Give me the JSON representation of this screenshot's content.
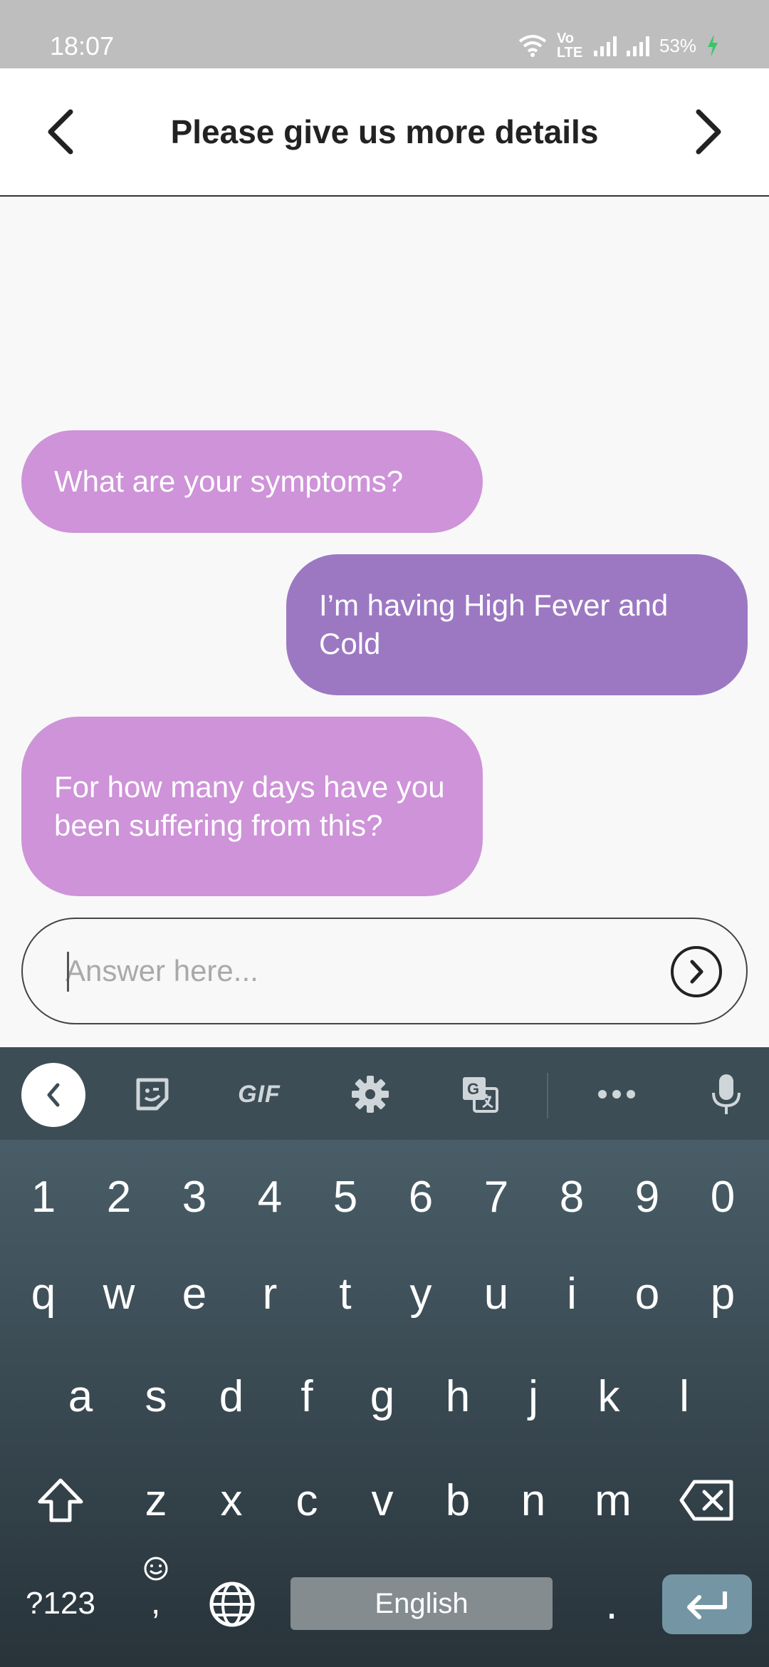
{
  "status_bar": {
    "time": "18:07",
    "network_label": "Vo LTE",
    "battery": "53%",
    "icons": [
      "wifi-icon",
      "signal-icon",
      "signal-icon",
      "battery-charging-icon"
    ]
  },
  "header": {
    "title": "Please give us more details",
    "back_icon": "chevron-left-icon",
    "next_icon": "chevron-right-icon"
  },
  "chat": {
    "messages": [
      {
        "sender": "bot",
        "text": "What are your symptoms?"
      },
      {
        "sender": "user",
        "text": "I’m having High Fever and Cold"
      },
      {
        "sender": "bot",
        "text": "For how many days have you been suffering from this?"
      }
    ],
    "colors": {
      "bot": "#ce93d8",
      "user": "#9c78c2"
    }
  },
  "answer": {
    "value": "",
    "placeholder": "Answer here...",
    "send_icon": "arrow-circle-right-icon"
  },
  "keyboard": {
    "toolbar": {
      "gif_label": "GIF",
      "icons": [
        "back-icon",
        "sticker-icon",
        "gif-icon",
        "gear-icon",
        "translate-icon",
        "more-icon",
        "mic-icon"
      ]
    },
    "number_row": [
      "1",
      "2",
      "3",
      "4",
      "5",
      "6",
      "7",
      "8",
      "9",
      "0"
    ],
    "row1": [
      "q",
      "w",
      "e",
      "r",
      "t",
      "y",
      "u",
      "i",
      "o",
      "p"
    ],
    "row2": [
      "a",
      "s",
      "d",
      "f",
      "g",
      "h",
      "j",
      "k",
      "l"
    ],
    "row3": [
      "z",
      "x",
      "c",
      "v",
      "b",
      "n",
      "m"
    ],
    "symbols_key": "?123",
    "comma_key": ",",
    "space_label": "English",
    "period_key": "."
  }
}
